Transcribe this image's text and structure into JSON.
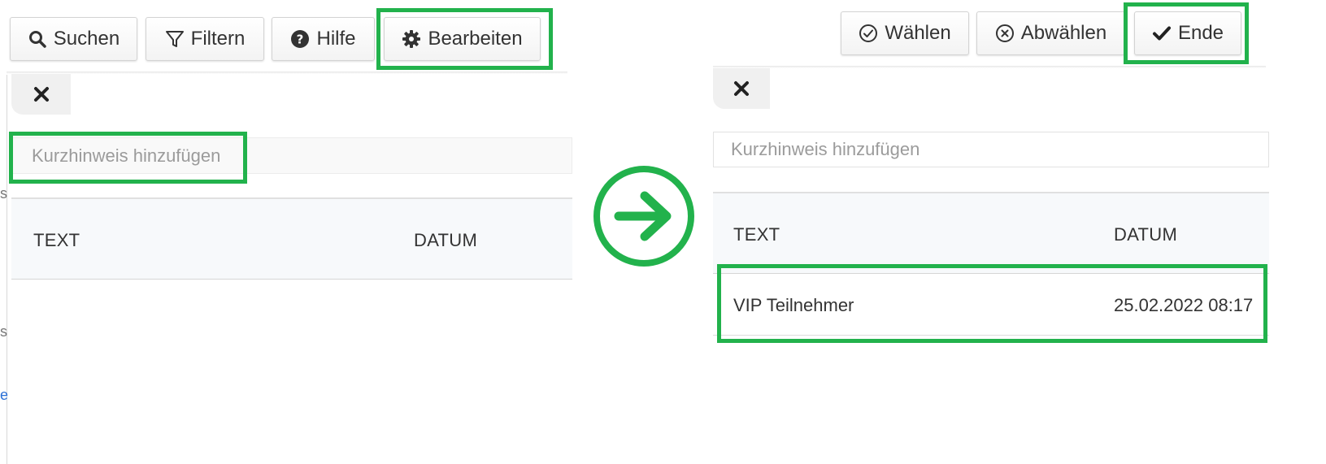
{
  "before": {
    "toolbar": {
      "search_label": "Suchen",
      "filter_label": "Filtern",
      "help_label": "Hilfe",
      "edit_label": "Bearbeiten"
    },
    "note_input": {
      "placeholder": "Kurzhinweis hinzufügen"
    },
    "table": {
      "columns": [
        "TEXT",
        "DATUM"
      ]
    }
  },
  "after": {
    "toolbar": {
      "select_label": "Wählen",
      "deselect_label": "Abwählen",
      "done_label": "Ende"
    },
    "note_input": {
      "placeholder": "Kurzhinweis hinzufügen"
    },
    "table": {
      "columns": [
        "TEXT",
        "DATUM"
      ],
      "rows": [
        {
          "text": "VIP Teilnehmer",
          "date": "25.02.2022 08:17"
        }
      ]
    }
  },
  "colors": {
    "highlight": "#22b24c",
    "text": "#333333",
    "placeholder": "#9b9b9b"
  },
  "icons": [
    "search-icon",
    "filter-icon",
    "help-icon",
    "gear-icon",
    "close-icon",
    "arrow-right-icon",
    "check-circle-icon",
    "x-circle-icon",
    "check-icon"
  ]
}
